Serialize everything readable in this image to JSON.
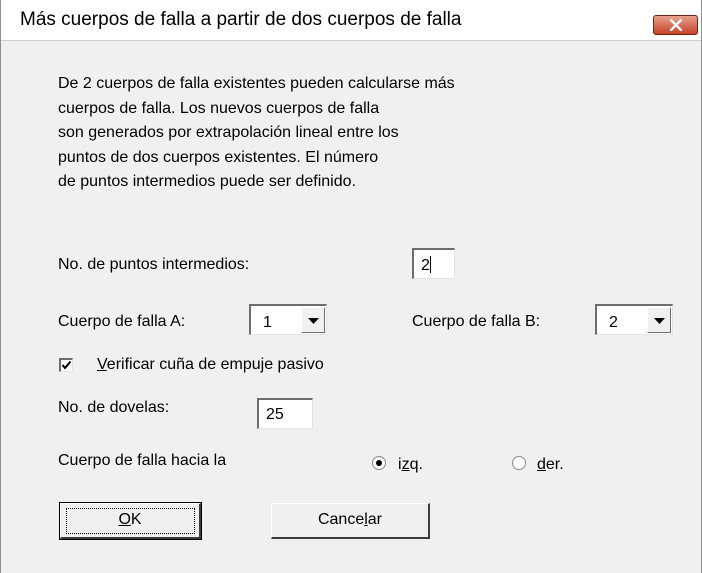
{
  "window": {
    "title": "Más cuerpos de falla a partir de dos cuerpos de falla",
    "close_icon": "close-x-icon"
  },
  "description": [
    "De 2 cuerpos de falla existentes pueden calcularse más",
    "cuerpos de falla. Los nuevos cuerpos de falla",
    "son generados por extrapolación lineal entre los",
    "puntos de dos cuerpos existentes. El número",
    "de puntos intermedios puede ser definido."
  ],
  "intermediate_points": {
    "label": "No. de puntos intermedios:",
    "value": "2"
  },
  "body_a": {
    "label": "Cuerpo de falla A:",
    "value": "1"
  },
  "body_b": {
    "label": "Cuerpo de falla B:",
    "value": "2"
  },
  "passive_wedge": {
    "label_first": "V",
    "label_rest": "erificar cuña de empuje pasivo",
    "checked": true
  },
  "slices": {
    "label": "No. de dovelas:",
    "value": "25"
  },
  "direction": {
    "label": "Cuerpo de falla hacia la",
    "left_first": "i",
    "left_mid": "z",
    "left_rest": "q.",
    "right_first": "d",
    "right_rest": "er.",
    "selected": "izq."
  },
  "buttons": {
    "ok_first": "O",
    "ok_rest": "K",
    "cancel_start": "Cance",
    "cancel_u": "l",
    "cancel_end": "ar"
  }
}
